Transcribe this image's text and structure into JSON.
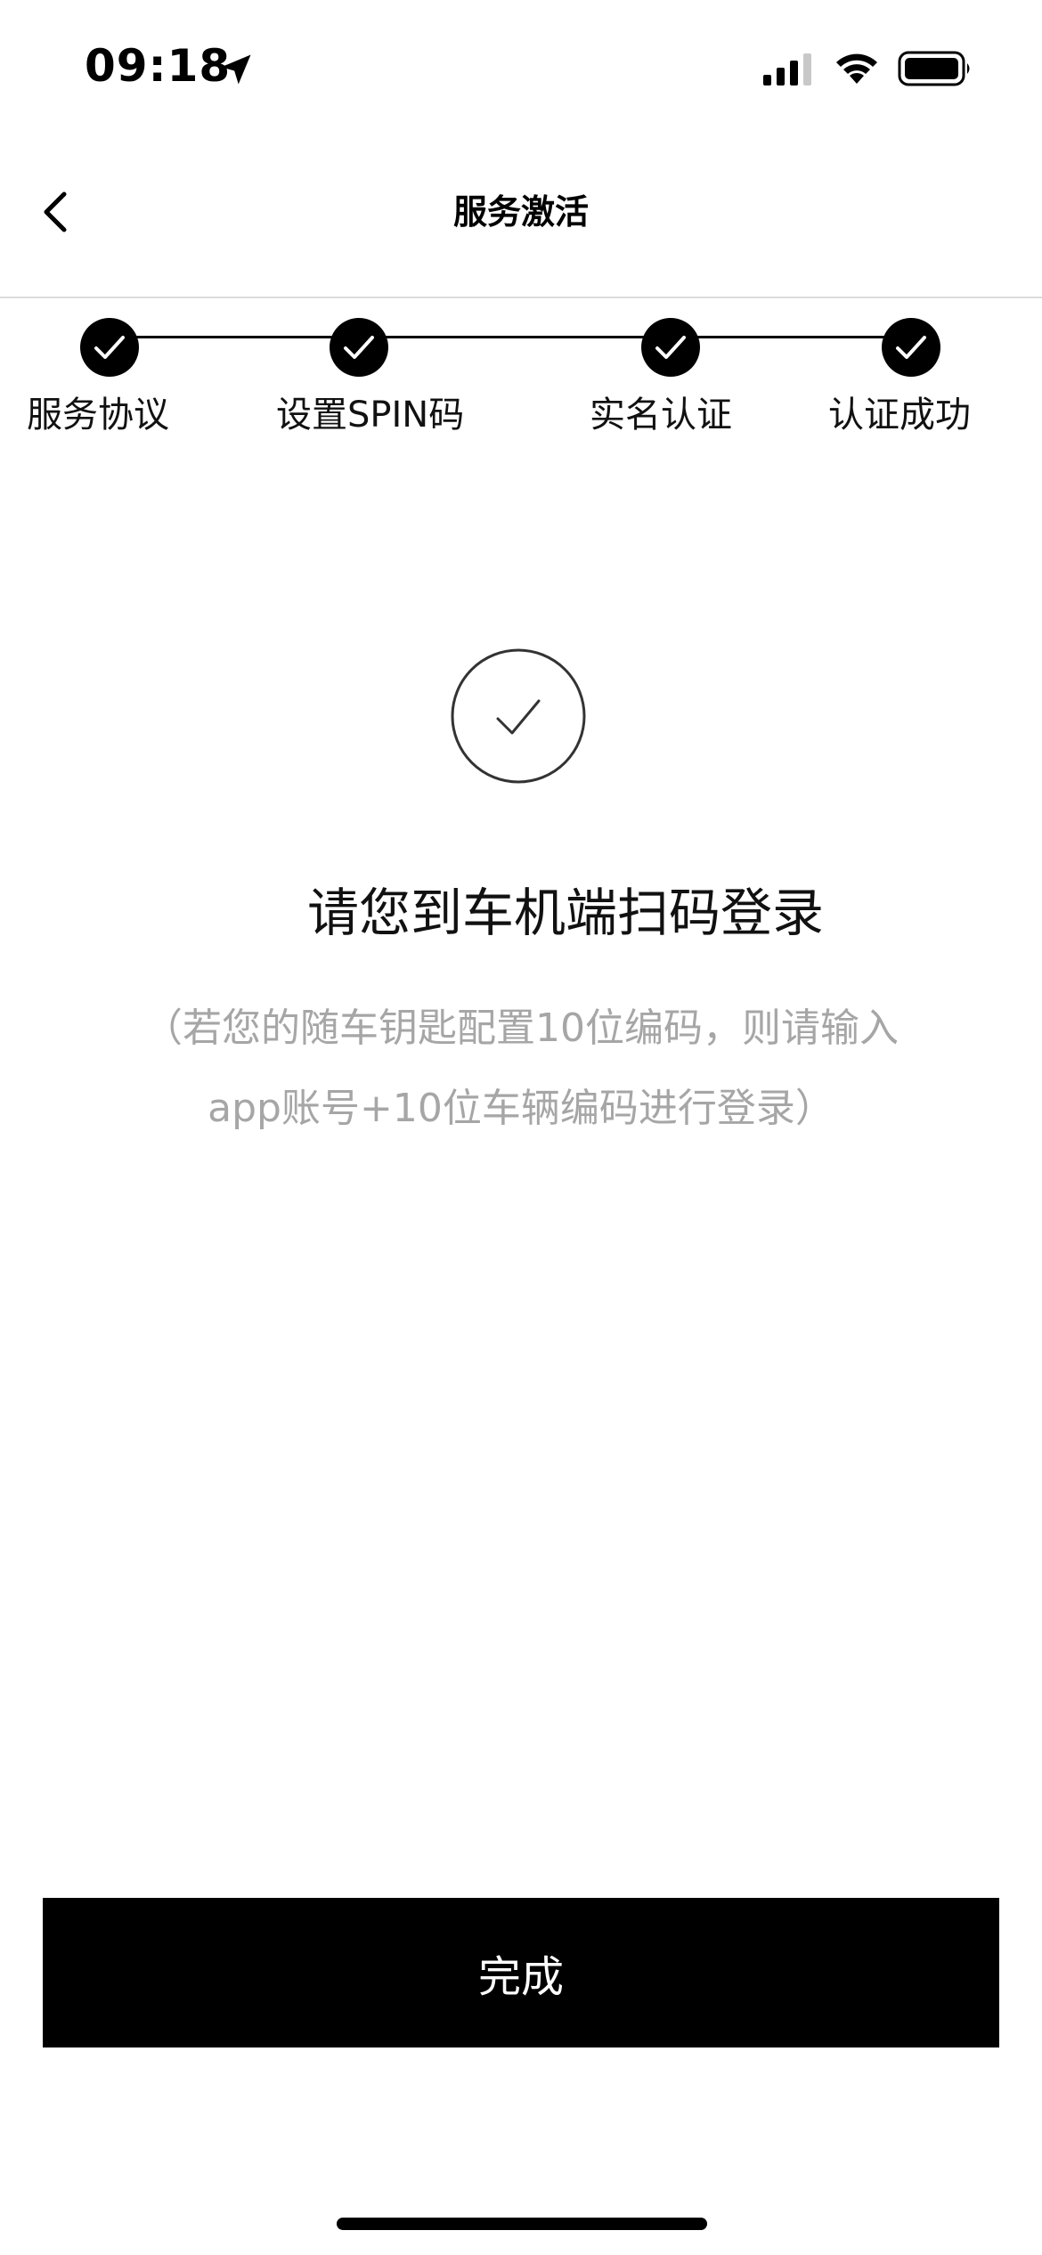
{
  "status_bar": {
    "time": "09:18",
    "icons": [
      "location-arrow-icon",
      "cellular-signal-icon",
      "wifi-icon",
      "battery-icon"
    ]
  },
  "nav": {
    "title": "服务激活",
    "back_icon": "chevron-left-icon"
  },
  "stepper": {
    "steps": [
      {
        "label": "服务协议",
        "completed": true
      },
      {
        "label": "设置SPIN码",
        "completed": true
      },
      {
        "label": "实名认证",
        "completed": true
      },
      {
        "label": "认证成功",
        "completed": true
      }
    ]
  },
  "content": {
    "success_icon": "check-circle-icon",
    "message": "请您到车机端扫码登录",
    "hint": "（若您的随车钥匙配置10位编码，则请输入app账号+10位车辆编码进行登录）"
  },
  "footer": {
    "done_label": "完成"
  },
  "colors": {
    "primary": "#000000",
    "hint_text": "#a6a6a6",
    "divider": "#dcdcdc"
  }
}
